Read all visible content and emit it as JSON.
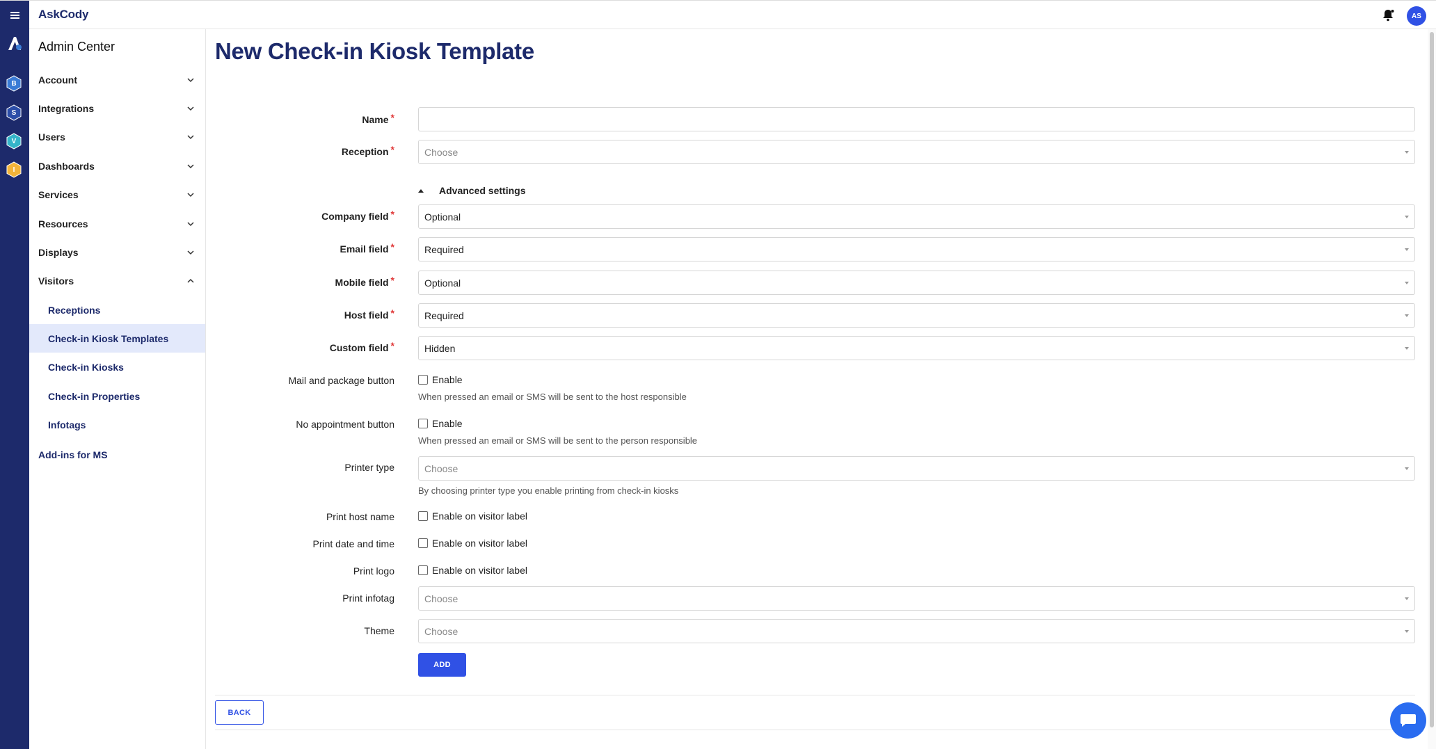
{
  "app": {
    "brand": "AskCody"
  },
  "header": {
    "avatar_initials": "AS"
  },
  "rail": {
    "apps": [
      {
        "letter": "B",
        "color": "#3a7bd5"
      },
      {
        "letter": "S",
        "color": "#2c4ea8"
      },
      {
        "letter": "V",
        "color": "#35b5c9"
      },
      {
        "letter": "I",
        "color": "#f2b43a"
      }
    ]
  },
  "sidebar": {
    "title": "Admin Center",
    "items": [
      {
        "label": "Account"
      },
      {
        "label": "Integrations"
      },
      {
        "label": "Users"
      },
      {
        "label": "Dashboards"
      },
      {
        "label": "Services"
      },
      {
        "label": "Resources"
      },
      {
        "label": "Displays"
      },
      {
        "label": "Visitors"
      }
    ],
    "visitors_sub": [
      {
        "label": "Receptions"
      },
      {
        "label": "Check-in Kiosk Templates"
      },
      {
        "label": "Check-in Kiosks"
      },
      {
        "label": "Check-in Properties"
      },
      {
        "label": "Infotags"
      }
    ],
    "addins_label": "Add-ins for MS"
  },
  "page": {
    "title": "New Check-in Kiosk Template"
  },
  "form": {
    "name_label": "Name",
    "name_value": "",
    "reception_label": "Reception",
    "reception_value": "Choose",
    "advanced_label": "Advanced settings",
    "company_label": "Company field",
    "company_value": "Optional",
    "email_label": "Email field",
    "email_value": "Required",
    "mobile_label": "Mobile field",
    "mobile_value": "Optional",
    "host_label": "Host field",
    "host_value": "Required",
    "custom_label": "Custom field",
    "custom_value": "Hidden",
    "mail_label": "Mail and package button",
    "mail_enable": "Enable",
    "mail_hint": "When pressed an email or SMS will be sent to the host responsible",
    "noappt_label": "No appointment button",
    "noappt_enable": "Enable",
    "noappt_hint": "When pressed an email or SMS will be sent to the person responsible",
    "printer_label": "Printer type",
    "printer_value": "Choose",
    "printer_hint": "By choosing printer type you enable printing from check-in kiosks",
    "print_host_label": "Print host name",
    "print_host_enable": "Enable on visitor label",
    "print_date_label": "Print date and time",
    "print_date_enable": "Enable on visitor label",
    "print_logo_label": "Print logo",
    "print_logo_enable": "Enable on visitor label",
    "print_infotag_label": "Print infotag",
    "print_infotag_value": "Choose",
    "theme_label": "Theme",
    "theme_value": "Choose",
    "add_button": "ADD",
    "back_button": "BACK",
    "required_mark": "*"
  }
}
